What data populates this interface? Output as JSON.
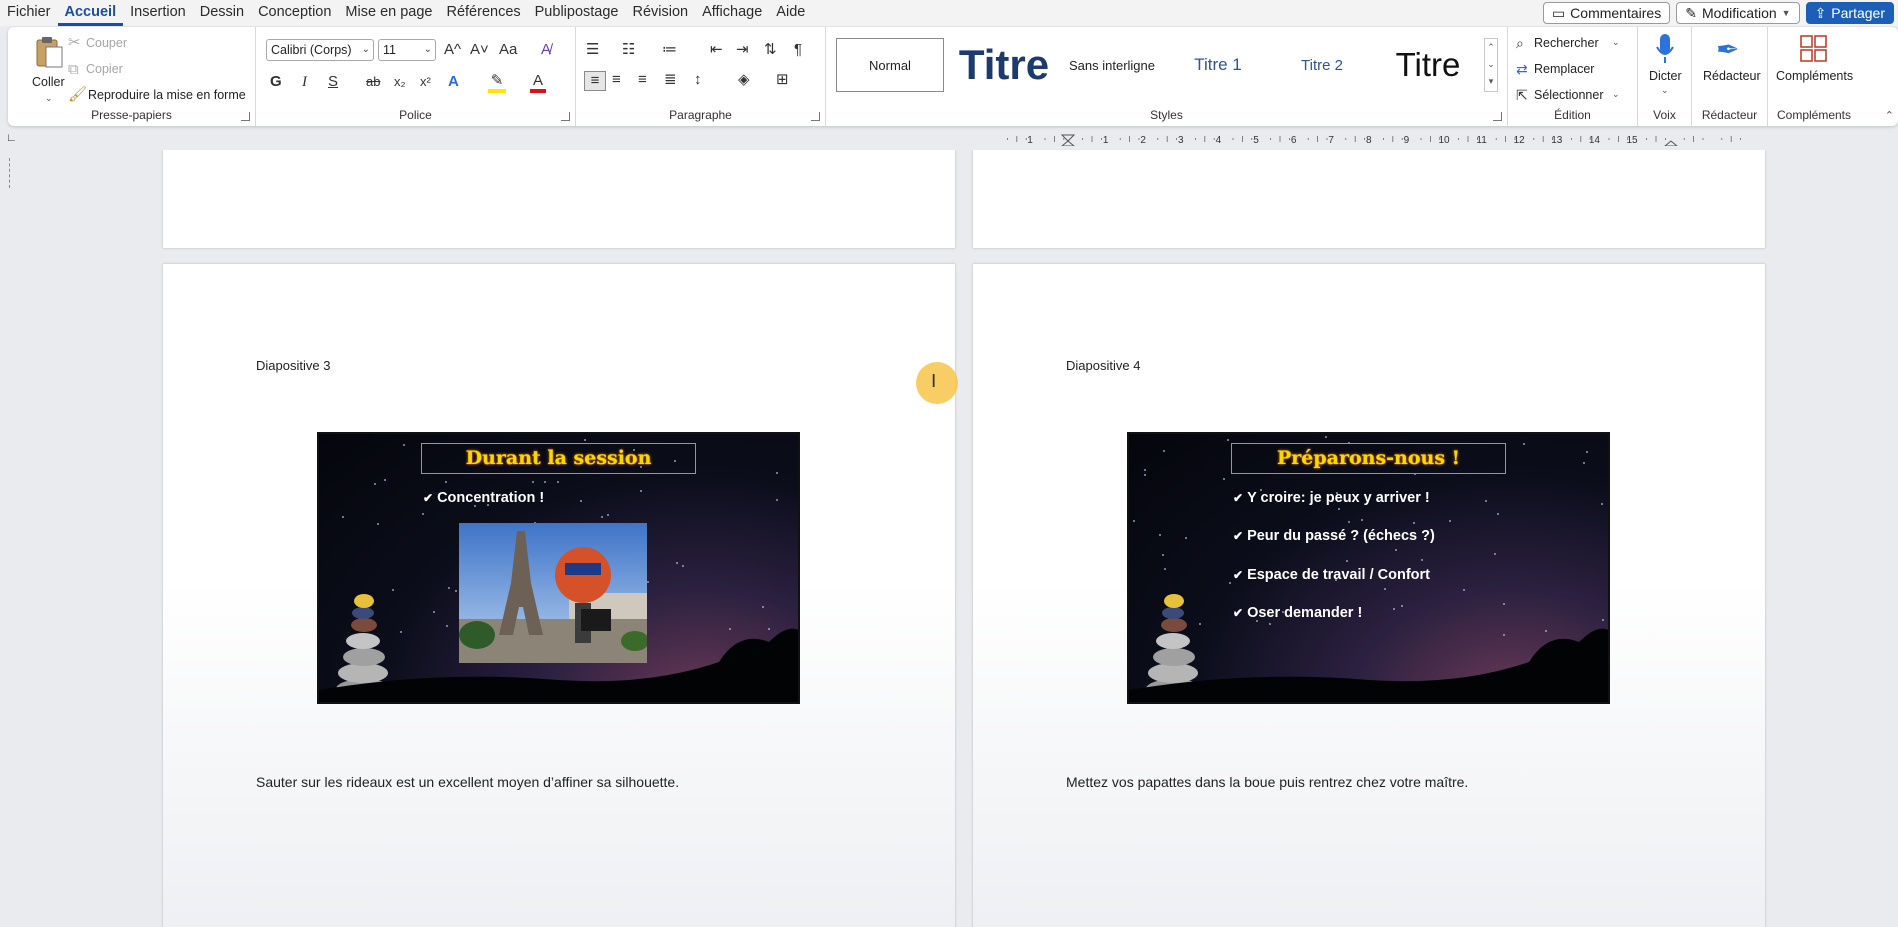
{
  "menu": {
    "tabs": [
      "Fichier",
      "Accueil",
      "Insertion",
      "Dessin",
      "Conception",
      "Mise en page",
      "Références",
      "Publipostage",
      "Révision",
      "Affichage",
      "Aide"
    ],
    "active_tab": "Accueil",
    "comments_label": "Commentaires",
    "mode_label": "Modification",
    "share_label": "Partager"
  },
  "ribbon": {
    "clipboard": {
      "label": "Presse-papiers",
      "paste": "Coller",
      "cut": "Couper",
      "copy": "Copier",
      "format_painter": "Reproduire la mise en forme"
    },
    "font": {
      "label": "Police",
      "font_name": "Calibri (Corps)",
      "font_size": "11",
      "grow": "A^",
      "shrink": "A˅",
      "case": "Aa",
      "bold": "G",
      "italic": "I",
      "underline": "S",
      "strike": "ab",
      "subscript": "x₂",
      "superscript": "x²"
    },
    "paragraph": {
      "label": "Paragraphe",
      "show_marks": "¶"
    },
    "styles": {
      "label": "Styles",
      "items": [
        "Normal",
        "Titre",
        "Sans interligne",
        "Titre 1",
        "Titre 2",
        "Titre"
      ]
    },
    "editing": {
      "label": "Édition",
      "find": "Rechercher",
      "replace": "Remplacer",
      "select": "Sélectionner"
    },
    "voice": {
      "label": "Voix",
      "dictate": "Dicter"
    },
    "editor": {
      "label": "Rédacteur",
      "button": "Rédacteur"
    },
    "addins": {
      "label": "Compléments",
      "button": "Compléments"
    }
  },
  "ruler": {
    "numbers": [
      "1",
      "1",
      "2",
      "3",
      "4",
      "5",
      "6",
      "7",
      "8",
      "9",
      "10",
      "11",
      "12",
      "13",
      "14",
      "15"
    ]
  },
  "document": {
    "slides": [
      {
        "caption": "Diapositive 3",
        "title": "Durant la session",
        "bullets": [
          "Concentration !"
        ],
        "note": "Sauter sur les rideaux est un excellent moyen d’affiner sa silhouette."
      },
      {
        "caption": "Diapositive 4",
        "title": "Préparons-nous !",
        "bullets": [
          "Y croire: je peux y arriver !",
          "Peur du passé ? (échecs ?)",
          "Espace de travail / Confort",
          "Oser demander !"
        ],
        "note": "Mettez vos papattes dans la boue puis rentrez chez votre maître."
      }
    ]
  },
  "colors": {
    "accent": "#1e4e9a",
    "title_text": "#f7d800",
    "cursor_highlight": "#f7c448"
  }
}
